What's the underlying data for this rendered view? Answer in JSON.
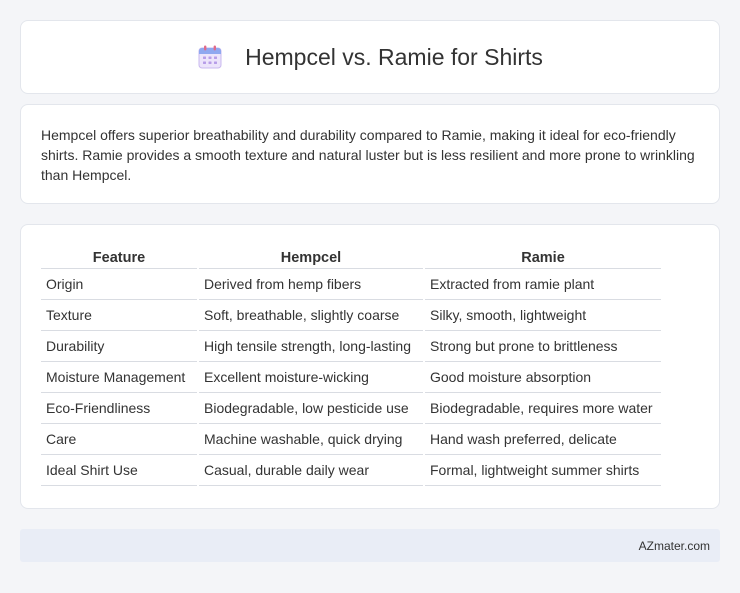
{
  "header": {
    "title": "Hempcel vs. Ramie for Shirts",
    "icon": "calendar-icon"
  },
  "summary": {
    "text": "Hempcel offers superior breathability and durability compared to Ramie, making it ideal for eco-friendly shirts. Ramie provides a smooth texture and natural luster but is less resilient and more prone to wrinkling than Hempcel."
  },
  "table": {
    "headers": [
      "Feature",
      "Hempcel",
      "Ramie"
    ],
    "rows": [
      [
        "Origin",
        "Derived from hemp fibers",
        "Extracted from ramie plant"
      ],
      [
        "Texture",
        "Soft, breathable, slightly coarse",
        "Silky, smooth, lightweight"
      ],
      [
        "Durability",
        "High tensile strength, long-lasting",
        "Strong but prone to brittleness"
      ],
      [
        "Moisture Management",
        "Excellent moisture-wicking",
        "Good moisture absorption"
      ],
      [
        "Eco-Friendliness",
        "Biodegradable, low pesticide use",
        "Biodegradable, requires more water"
      ],
      [
        "Care",
        "Machine washable, quick drying",
        "Hand wash preferred, delicate"
      ],
      [
        "Ideal Shirt Use",
        "Casual, durable daily wear",
        "Formal, lightweight summer shirts"
      ]
    ]
  },
  "footer": {
    "site": "AZmater.com"
  }
}
